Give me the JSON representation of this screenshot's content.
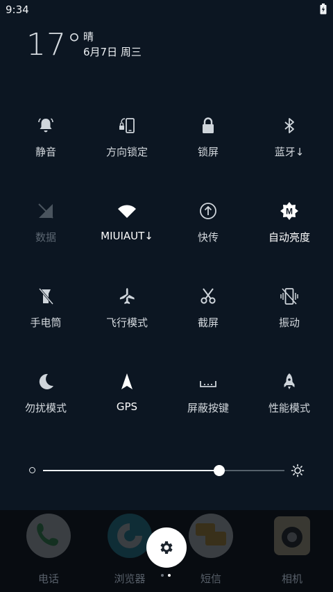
{
  "status": {
    "time": "9:34"
  },
  "weather": {
    "temperature": "17°",
    "condition": "晴",
    "date": "6月7日 周三"
  },
  "tiles": [
    {
      "label": "静音",
      "icon": "bell-icon",
      "state": "normal"
    },
    {
      "label": "方向锁定",
      "icon": "rotation-lock-icon",
      "state": "normal"
    },
    {
      "label": "锁屏",
      "icon": "lock-icon",
      "state": "normal"
    },
    {
      "label": "蓝牙↓",
      "icon": "bluetooth-icon",
      "state": "normal"
    },
    {
      "label": "数据",
      "icon": "mobile-data-icon",
      "state": "dim"
    },
    {
      "label": "MIUIAUT↓",
      "icon": "wifi-icon",
      "state": "on"
    },
    {
      "label": "快传",
      "icon": "quick-transfer-icon",
      "state": "normal"
    },
    {
      "label": "自动亮度",
      "icon": "auto-brightness-icon",
      "state": "on"
    },
    {
      "label": "手电筒",
      "icon": "flashlight-icon",
      "state": "normal"
    },
    {
      "label": "飞行模式",
      "icon": "airplane-icon",
      "state": "normal"
    },
    {
      "label": "截屏",
      "icon": "scissors-icon",
      "state": "normal"
    },
    {
      "label": "振动",
      "icon": "vibrate-icon",
      "state": "normal"
    },
    {
      "label": "勿扰模式",
      "icon": "moon-icon",
      "state": "normal"
    },
    {
      "label": "GPS",
      "icon": "gps-arrow-icon",
      "state": "on"
    },
    {
      "label": "屏蔽按键",
      "icon": "block-keys-icon",
      "state": "normal"
    },
    {
      "label": "性能模式",
      "icon": "rocket-icon",
      "state": "normal"
    }
  ],
  "brightness": {
    "level": 0.73
  },
  "dock": [
    {
      "label": "电话",
      "icon": "phone-app-icon",
      "color": "#3fae5a"
    },
    {
      "label": "浏览器",
      "icon": "browser-app-icon",
      "color": "#2aa3b8"
    },
    {
      "label": "短信",
      "icon": "messages-app-icon",
      "color": "#e8b23a"
    },
    {
      "label": "相机",
      "icon": "camera-app-icon",
      "color": "#e6d6a8"
    }
  ],
  "pager": {
    "count": 2,
    "active": 1
  },
  "colors": {
    "background": "#0c1622",
    "text": "#d3d8dd",
    "dim": "#5b6671",
    "accent": "#ffffff"
  }
}
